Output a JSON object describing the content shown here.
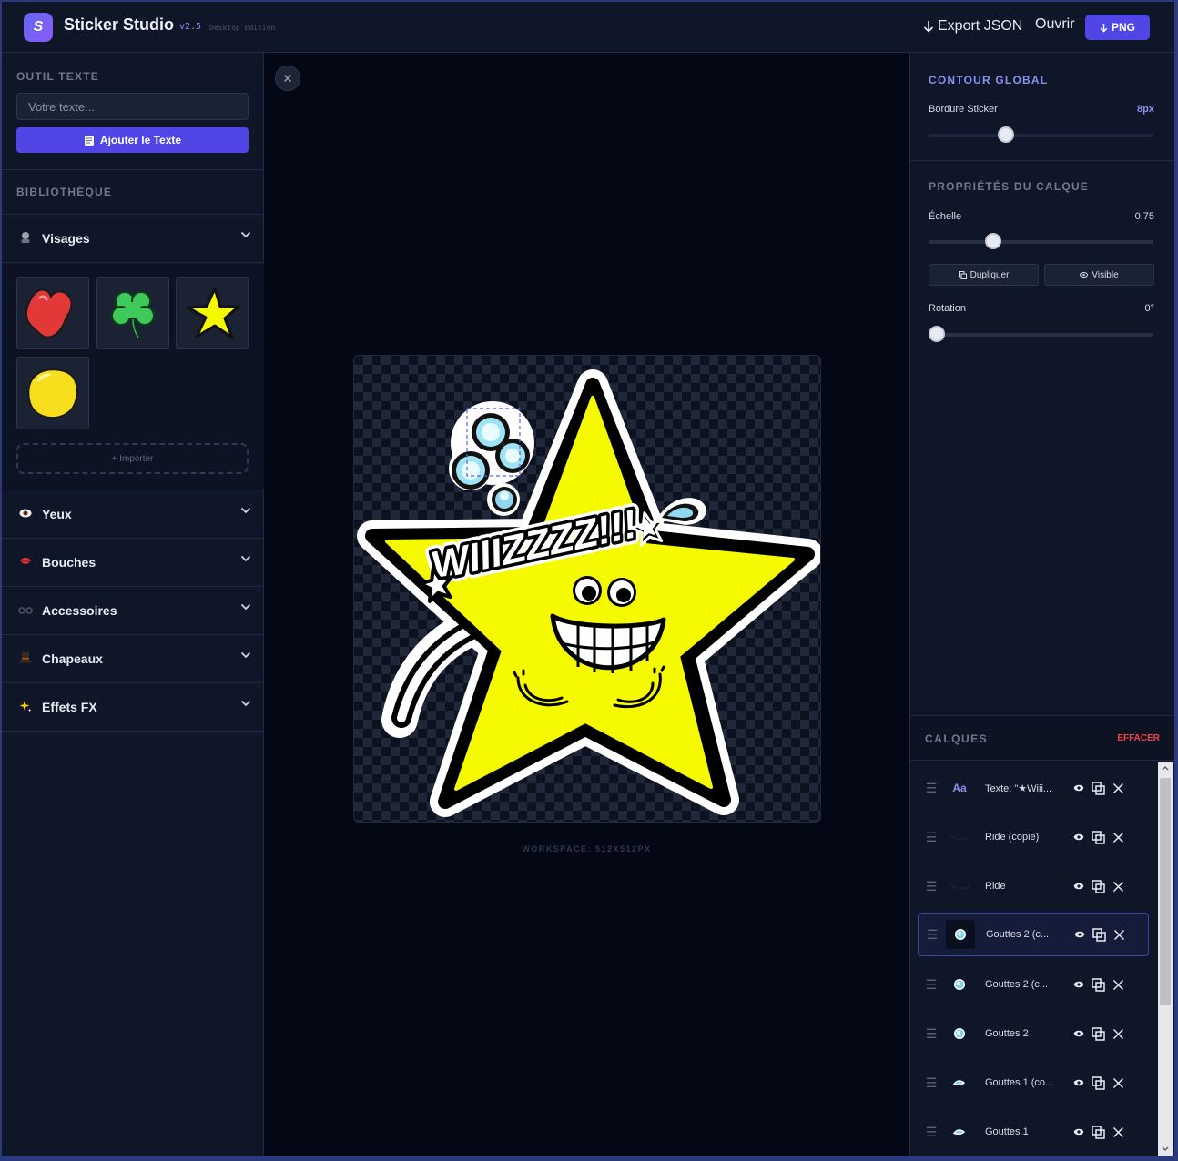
{
  "header": {
    "app_title": "Sticker Studio",
    "version": "v2.5",
    "edition": "Desktop Edition",
    "export_json_label": "Export JSON",
    "open_label": "Ouvrir",
    "png_label": "PNG"
  },
  "left": {
    "text_tool_title": "OUTIL TEXTE",
    "text_placeholder": "Votre texte...",
    "add_text_label": "Ajouter le Texte",
    "library_title": "BIBLIOTHÈQUE",
    "import_label": "+ Importer",
    "categories": [
      {
        "label": "Visages",
        "icon": "face-icon",
        "expanded": true
      },
      {
        "label": "Yeux",
        "icon": "eye-icon"
      },
      {
        "label": "Bouches",
        "icon": "mouth-icon"
      },
      {
        "label": "Accessoires",
        "icon": "glasses-icon"
      },
      {
        "label": "Chapeaux",
        "icon": "top-hat-icon"
      },
      {
        "label": "Effets FX",
        "icon": "sparkle-icon"
      }
    ],
    "library_items": [
      "heart-sticker",
      "clover-sticker",
      "star-sticker",
      "blob-sticker"
    ]
  },
  "canvas": {
    "sticker_text": "WIIIZZZZ!!!",
    "workspace_label": "WORKSPACE: 512X512PX"
  },
  "right": {
    "global_outline_title": "CONTOUR GLOBAL",
    "border_label": "Bordure Sticker",
    "border_value": "8px",
    "border_level": 0.33,
    "layer_props_title": "PROPRIÉTÉS DU CALQUE",
    "scale_label": "Échelle",
    "scale_value": "0.75",
    "scale_level": 0.27,
    "duplicate_label": "Dupliquer",
    "visible_label": "Visible",
    "rotation_label": "Rotation",
    "rotation_value": "0°",
    "rotation_level": 0,
    "layers_title": "CALQUES",
    "clear_label": "EFFACER",
    "text_thumb_label": "Aa",
    "layers": [
      {
        "name": "Texte: \"★Wiii...",
        "thumb": "text"
      },
      {
        "name": "Ride (copie)",
        "thumb": "wrinkle"
      },
      {
        "name": "Ride",
        "thumb": "wrinkle"
      },
      {
        "name": "Gouttes 2 (c...",
        "thumb": "drop",
        "selected": true
      },
      {
        "name": "Gouttes 2 (c...",
        "thumb": "drop"
      },
      {
        "name": "Gouttes 2",
        "thumb": "drop"
      },
      {
        "name": "Gouttes 1 (co...",
        "thumb": "drop-small"
      },
      {
        "name": "Gouttes 1",
        "thumb": "drop-small"
      }
    ]
  },
  "colors": {
    "accent": "#4f46e5",
    "accent_text": "#8b8ff0",
    "danger": "#ef4444",
    "sticker_yellow": "#f5fa00"
  }
}
